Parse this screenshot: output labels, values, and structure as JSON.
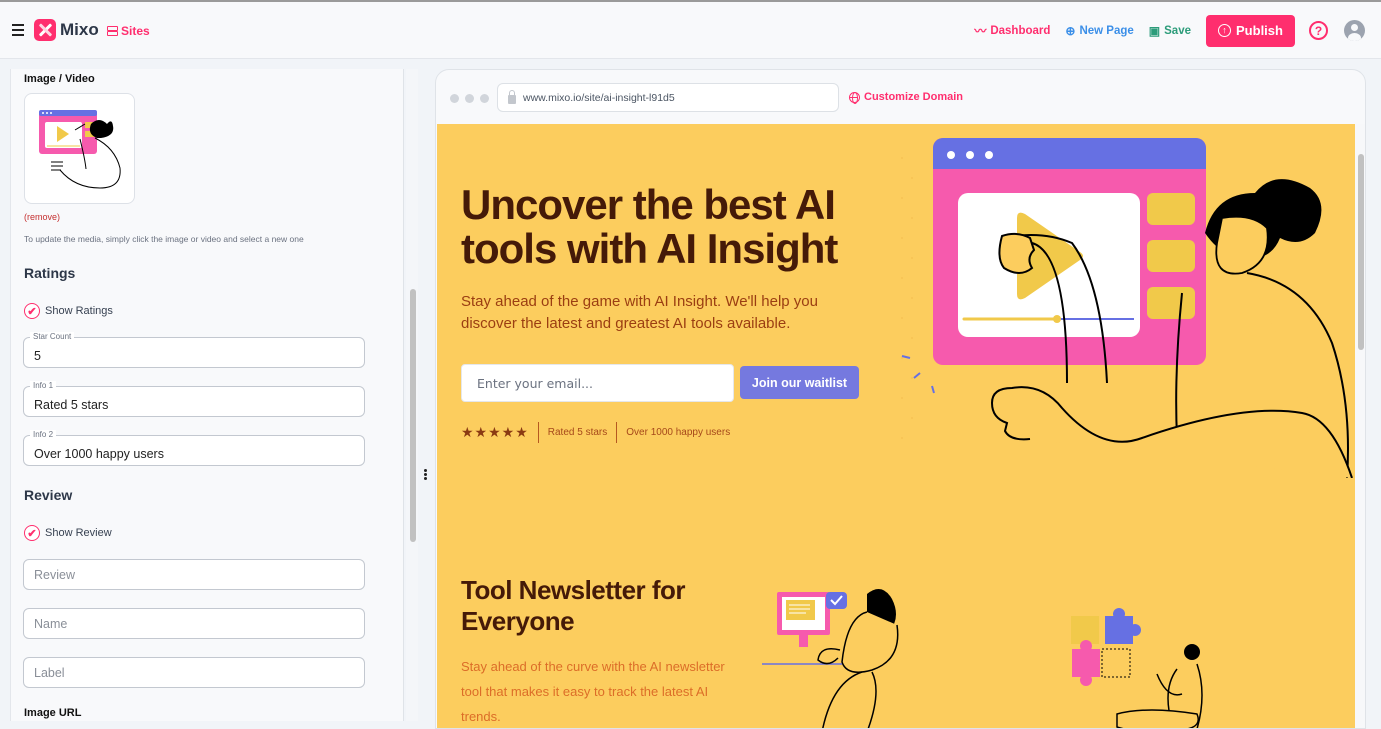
{
  "app": {
    "name": "Mixo",
    "sites_label": "Sites"
  },
  "topnav": {
    "dashboard_label": "Dashboard",
    "new_page_label": "New Page",
    "save_label": "Save",
    "publish_label": "Publish",
    "help_glyph": "?"
  },
  "editor": {
    "media": {
      "section_label": "Image / Video",
      "remove_label": "(remove)",
      "hint": "To update the media, simply click the image or video and select a new one"
    },
    "ratings": {
      "title": "Ratings",
      "show_label": "Show Ratings",
      "show_checked": true,
      "star_count": {
        "label": "Star Count",
        "value": "5"
      },
      "info1": {
        "label": "Info 1",
        "value": "Rated 5 stars"
      },
      "info2": {
        "label": "Info 2",
        "value": "Over 1000 happy users"
      }
    },
    "review": {
      "title": "Review",
      "show_label": "Show Review",
      "show_checked": true,
      "review_placeholder": "Review",
      "name_placeholder": "Name",
      "label_placeholder": "Label"
    },
    "image_url_label": "Image URL"
  },
  "preview": {
    "url": "www.mixo.io/site/ai-insight-l91d5",
    "customize_domain_label": "Customize Domain",
    "hero": {
      "title": "Uncover the best AI tools with AI Insight",
      "subtitle": "Stay ahead of the game with AI Insight. We'll help you discover the latest and greatest AI tools available.",
      "email_placeholder": "Enter your email...",
      "cta_label": "Join our waitlist",
      "stars": "★★★★★",
      "info1": "Rated 5 stars",
      "info2": "Over 1000 happy users"
    },
    "section2": {
      "title": "Tool Newsletter for Everyone",
      "text": "Stay ahead of the curve with the AI newsletter tool that makes it easy to track the latest AI trends."
    },
    "colors": {
      "background": "#fccd5e",
      "heading": "#451a08",
      "accent": "#7579df",
      "brand": "#ff2e6e"
    }
  }
}
